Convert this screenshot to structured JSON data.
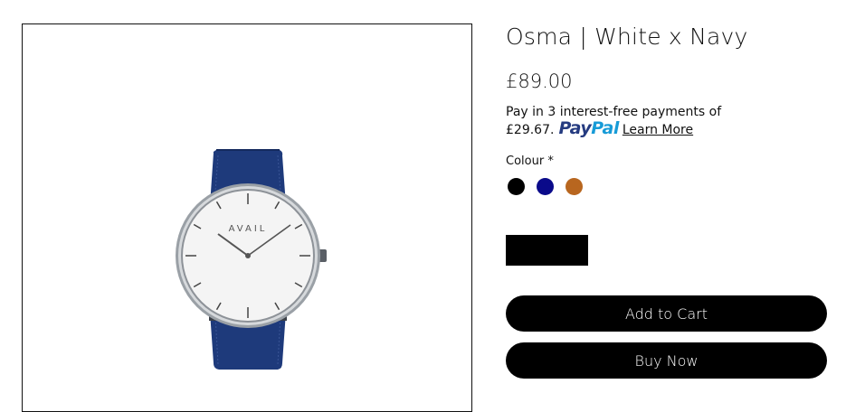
{
  "product": {
    "title": "Osma | White x Navy",
    "price": "£89.00",
    "image_alt": "AVAIL watch with white dial and navy leather strap",
    "watch_brand_text": "AVAIL"
  },
  "payment": {
    "line1": "Pay in 3 interest-free payments of",
    "amount": "£29.67.",
    "paypal_pay": "Pay",
    "paypal_pal": "Pal",
    "learn_more": "Learn More"
  },
  "options": {
    "colour_label": "Colour *",
    "swatches": [
      {
        "name": "black",
        "color": "#000000"
      },
      {
        "name": "navy",
        "color": "#0a0a8a"
      },
      {
        "name": "tan",
        "color": "#b8661f"
      }
    ]
  },
  "actions": {
    "add_to_cart": "Add to Cart",
    "buy_now": "Buy Now"
  },
  "colors": {
    "button_bg": "#000000",
    "strap": "#1f3a7a",
    "dial": "#f5f5f5"
  }
}
